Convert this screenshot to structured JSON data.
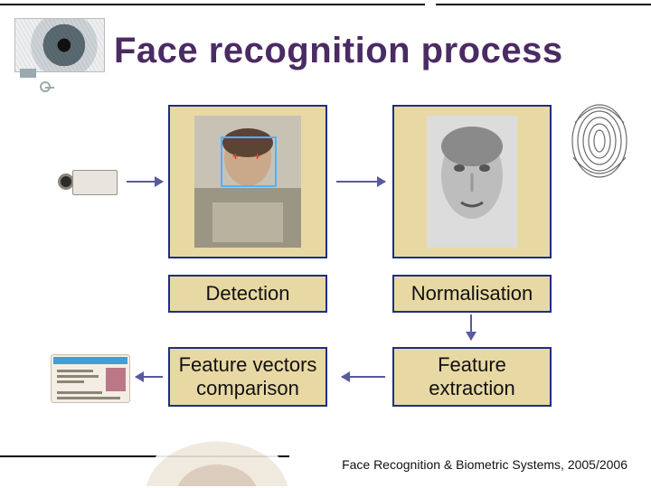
{
  "title": "Face recognition process",
  "labels": {
    "detection": "Detection",
    "normalisation": "Normalisation",
    "comparison": "Feature vectors comparison",
    "extraction": "Feature extraction"
  },
  "footer": "Face Recognition & Biometric Systems, 2005/2006",
  "icons": {
    "eye": "eye-image",
    "fingerprint": "fingerprint-image",
    "camera": "camera-icon",
    "idcard": "id-card-image",
    "bottom_face": "face-crop-image"
  }
}
